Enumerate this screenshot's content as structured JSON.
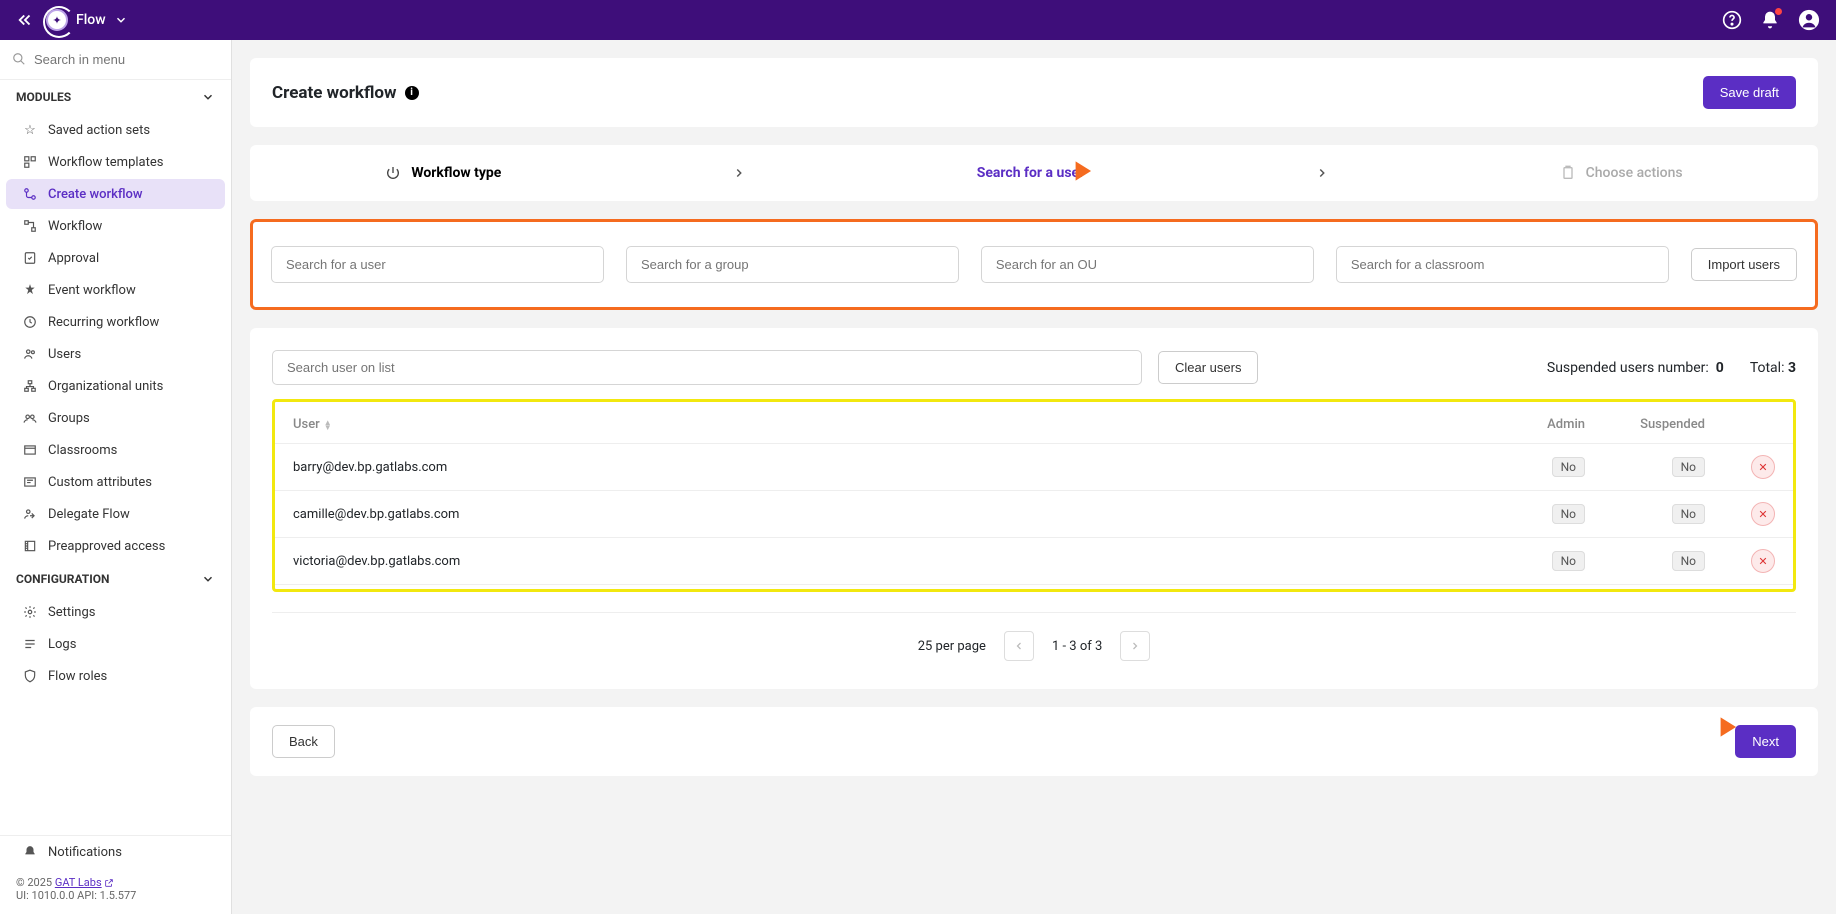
{
  "topbar": {
    "app_name": "Flow"
  },
  "sidebar": {
    "search_placeholder": "Search in menu",
    "sections": {
      "modules": "MODULES",
      "configuration": "CONFIGURATION"
    },
    "modules": [
      {
        "label": "Saved action sets"
      },
      {
        "label": "Workflow templates"
      },
      {
        "label": "Create workflow"
      },
      {
        "label": "Workflow"
      },
      {
        "label": "Approval"
      },
      {
        "label": "Event workflow"
      },
      {
        "label": "Recurring workflow"
      },
      {
        "label": "Users"
      },
      {
        "label": "Organizational units"
      },
      {
        "label": "Groups"
      },
      {
        "label": "Classrooms"
      },
      {
        "label": "Custom attributes"
      },
      {
        "label": "Delegate Flow"
      },
      {
        "label": "Preapproved access"
      }
    ],
    "config_items": [
      {
        "label": "Settings"
      },
      {
        "label": "Logs"
      },
      {
        "label": "Flow roles"
      }
    ],
    "notifications_label": "Notifications",
    "footer": {
      "copyright_prefix": "© 2025 ",
      "link_text": "GAT Labs",
      "version": "UI: 1010.0.0 API: 1.5.577"
    }
  },
  "header": {
    "title": "Create workflow",
    "save_draft": "Save draft"
  },
  "stepper": {
    "step1": "Workflow type",
    "step2": "Search for a user",
    "step3": "Choose actions"
  },
  "search_row": {
    "user": "Search for a user",
    "group": "Search for a group",
    "ou": "Search for an OU",
    "classroom": "Search for a classroom",
    "import": "Import users"
  },
  "list": {
    "filter_placeholder": "Search user on list",
    "clear": "Clear users",
    "suspended_label": "Suspended users number:",
    "suspended_count": "0",
    "total_label": "Total:",
    "total_count": "3",
    "columns": {
      "user": "User",
      "admin": "Admin",
      "suspended": "Suspended"
    },
    "rows": [
      {
        "email": "barry@dev.bp.gatlabs.com",
        "admin": "No",
        "suspended": "No"
      },
      {
        "email": "camille@dev.bp.gatlabs.com",
        "admin": "No",
        "suspended": "No"
      },
      {
        "email": "victoria@dev.bp.gatlabs.com",
        "admin": "No",
        "suspended": "No"
      }
    ],
    "pager": {
      "per_page": "25 per page",
      "range": "1 - 3 of 3"
    }
  },
  "footer_nav": {
    "back": "Back",
    "next": "Next"
  }
}
